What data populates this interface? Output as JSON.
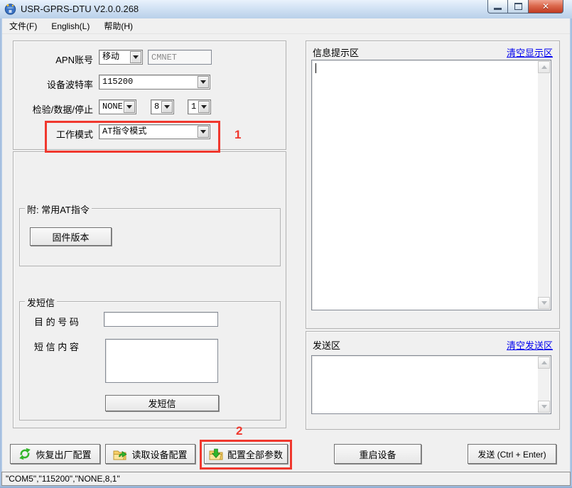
{
  "window": {
    "title": "USR-GPRS-DTU V2.0.0.268",
    "close_glyph": "✕"
  },
  "menu": {
    "items": [
      {
        "label": "文件(F)"
      },
      {
        "label": "English(L)"
      },
      {
        "label": "帮助(H)"
      }
    ]
  },
  "settings": {
    "apn": {
      "label": "APN账号",
      "selected": "移动",
      "value": "CMNET"
    },
    "baud": {
      "label": "设备波特率",
      "selected": "115200"
    },
    "serial": {
      "label": "检验/数据/停止",
      "parity": "NONE",
      "data_bits": "8",
      "stop_bits": "1"
    },
    "work_mode": {
      "label": "工作模式",
      "selected": "AT指令模式",
      "annotation": "1"
    }
  },
  "at_group": {
    "title": "附: 常用AT指令",
    "firmware_button": "固件版本"
  },
  "sms_group": {
    "title": "发短信",
    "dest_label": "目 的 号 码",
    "content_label": "短 信 内 容",
    "send_button": "发短信"
  },
  "info_panel": {
    "title": "信息提示区",
    "clear_link": "清空显示区",
    "content": ""
  },
  "send_panel": {
    "title": "发送区",
    "clear_link": "清空发送区",
    "content": ""
  },
  "actions": {
    "restore_factory": "恢复出厂配置",
    "read_config": "读取设备配置",
    "set_all_params": "配置全部参数",
    "annotation": "2",
    "restart_device": "重启设备",
    "send": "发送 (Ctrl + Enter)"
  },
  "status_bar": {
    "text": "\"COM5\",\"115200\",\"NONE,8,1\""
  },
  "colors": {
    "annotation_red": "#f0382e",
    "link_blue": "#0000ee",
    "titlebar_blue": "#c9dcf2",
    "frame_blue": "#9db9dc",
    "icon_green": "#33b52b",
    "folder_yellow": "#f8d069"
  },
  "icons": {
    "restore": "refresh-arrows-icon",
    "read": "folder-export-icon",
    "configure": "folder-download-icon"
  }
}
